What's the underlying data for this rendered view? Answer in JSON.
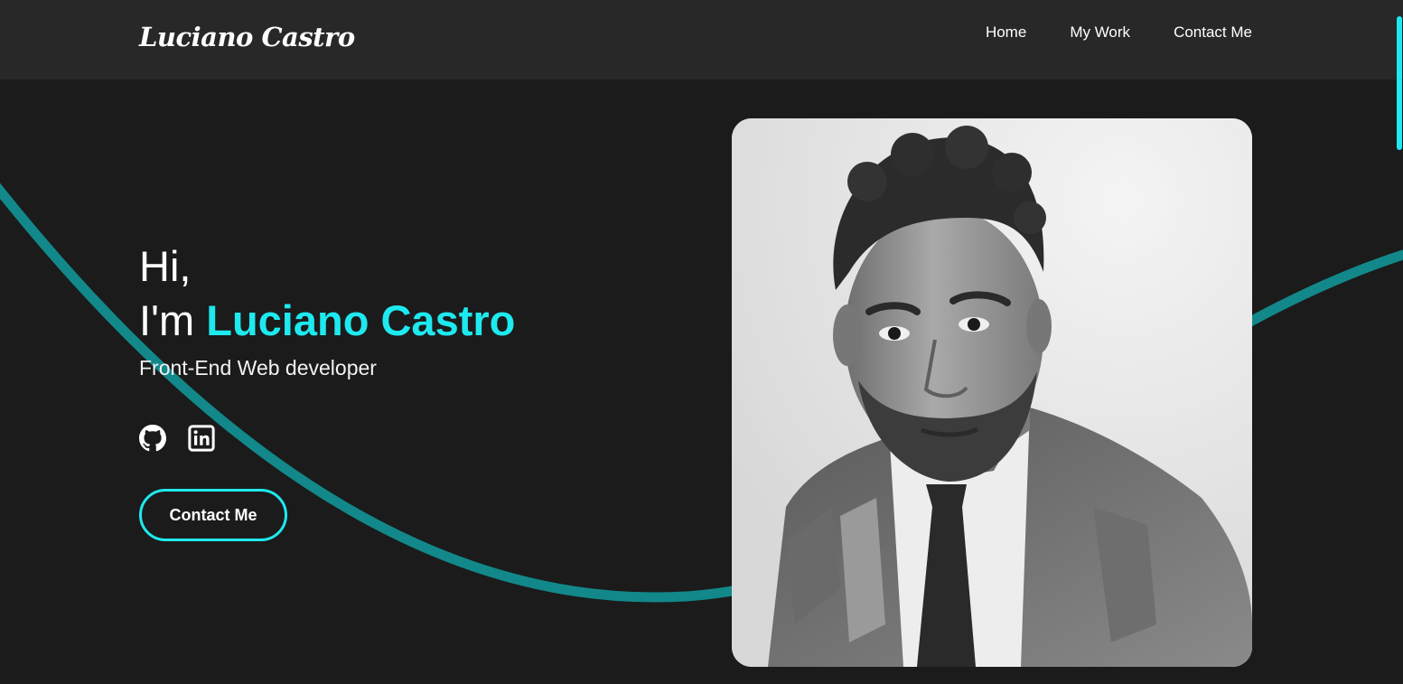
{
  "header": {
    "logo": "Luciano Castro",
    "nav": [
      {
        "label": "Home"
      },
      {
        "label": "My Work"
      },
      {
        "label": "Contact Me"
      }
    ]
  },
  "hero": {
    "greeting": "Hi,",
    "intro_prefix": "I'm ",
    "name": "Luciano Castro",
    "role": "Front-End Web developer",
    "cta_label": "Contact Me",
    "socials": [
      {
        "icon": "github-icon"
      },
      {
        "icon": "linkedin-icon"
      }
    ]
  },
  "colors": {
    "accent": "#1ee9ef",
    "curve": "#12888a",
    "background": "#1b1b1b",
    "header": "#282828"
  }
}
